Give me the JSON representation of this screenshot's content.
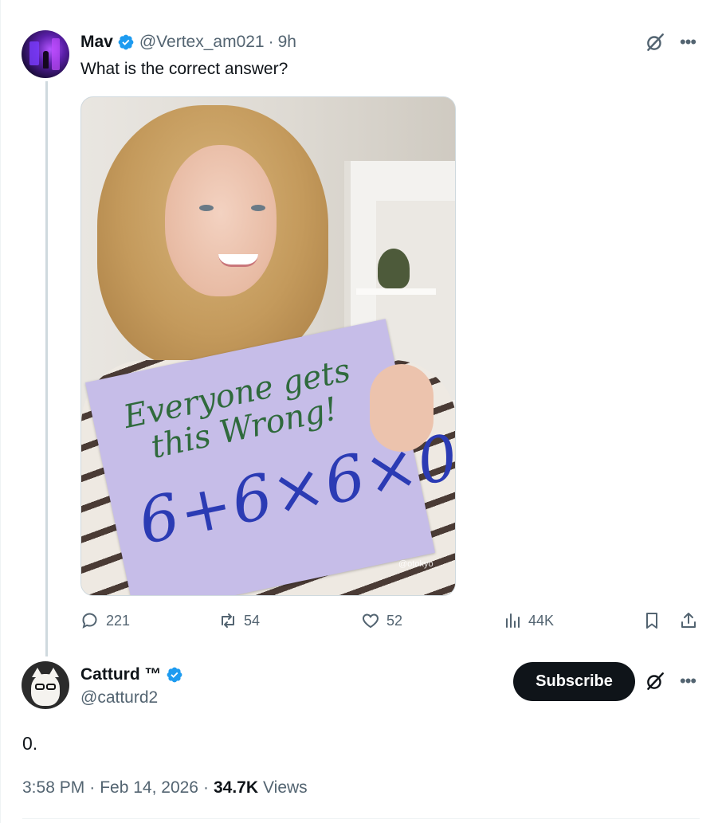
{
  "parent_tweet": {
    "author_name": "Mav",
    "handle": "@Vertex_am021",
    "separator": "·",
    "time": "9h",
    "text": "What is the correct answer?",
    "media": {
      "sign_title_line1": "Everyone gets",
      "sign_title_line2": "this Wrong!",
      "sign_math": "6+6×6×0",
      "watermark": "@otokyo_"
    },
    "actions": {
      "replies": "221",
      "reposts": "54",
      "likes": "52",
      "views": "44K"
    }
  },
  "reply_tweet": {
    "author_name": "Catturd ™",
    "handle": "@catturd2",
    "subscribe_label": "Subscribe",
    "text": "0.",
    "time": "3:58 PM",
    "separator": "·",
    "date": "Feb 14, 2026",
    "views_count": "34.7K",
    "views_label": "Views"
  },
  "icons": {
    "verified": "verified-badge-icon",
    "grok": "grok-icon",
    "more": "more-icon",
    "reply": "reply-icon",
    "repost": "repost-icon",
    "like": "heart-icon",
    "views": "views-chart-icon",
    "bookmark": "bookmark-icon",
    "share": "share-icon"
  },
  "colors": {
    "verified": "#1d9bf0",
    "secondary_text": "#536471",
    "primary_text": "#0f1419",
    "subscribe_bg": "#0f1419"
  }
}
